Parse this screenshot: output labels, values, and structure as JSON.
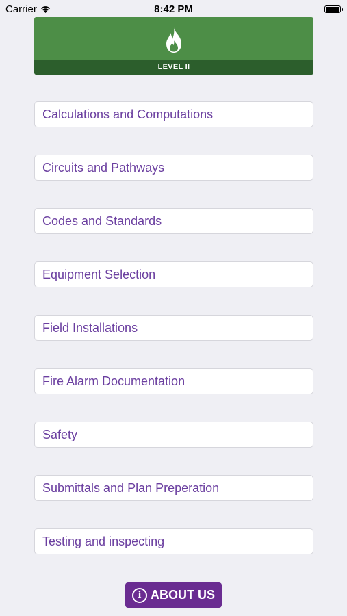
{
  "status_bar": {
    "carrier": "Carrier",
    "time": "8:42 PM",
    "wifi_icon": "wifi-icon",
    "battery_icon": "battery-icon"
  },
  "banner": {
    "logo_icon": "flame-icon",
    "level_label": "LEVEL II",
    "background_color": "#4d8e47",
    "strip_color": "#2c5e2c"
  },
  "menu": {
    "items": [
      {
        "label": "Calculations and Computations"
      },
      {
        "label": "Circuits and Pathways"
      },
      {
        "label": "Codes and Standards"
      },
      {
        "label": "Equipment Selection"
      },
      {
        "label": "Field Installations"
      },
      {
        "label": "Fire Alarm Documentation"
      },
      {
        "label": "Safety"
      },
      {
        "label": "Submittals and Plan Preperation"
      },
      {
        "label": "Testing and inspecting"
      }
    ],
    "text_color": "#6b3fa0"
  },
  "about": {
    "label": "ABOUT US",
    "icon": "info-icon",
    "background_color": "#6a2c91"
  }
}
